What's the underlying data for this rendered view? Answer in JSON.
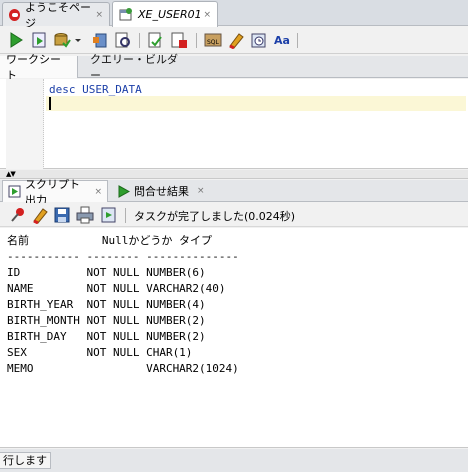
{
  "doc_tabs": [
    {
      "label": "ようこそページ",
      "close": "×"
    },
    {
      "label": "XE_USER01",
      "close": "×"
    }
  ],
  "toolbar_icons": [
    "run-statement-icon",
    "run-script-icon",
    "commit-icon",
    "rollback-icon",
    "autotrace-icon",
    "explain-plan-icon",
    "sql-tuning-icon",
    "monitor-icon",
    "clear-icon",
    "history-icon",
    "format-case-icon"
  ],
  "worksheet_tabs": {
    "worksheet": "ワークシート",
    "query_builder": "クエリー・ビルダー"
  },
  "editor": {
    "line1": "desc USER_DATA",
    "line2": ""
  },
  "output_tabs": [
    {
      "label": "スクリプト出力",
      "close": "×"
    },
    {
      "label": "問合せ結果",
      "close": "×"
    }
  ],
  "output_toolbar": {
    "status": "タスクが完了しました(0.024秒)"
  },
  "output": {
    "lines": [
      "名前           Nullかどうか タイプ",
      "----------- -------- --------------",
      "ID          NOT NULL NUMBER(6)",
      "NAME        NOT NULL VARCHAR2(40)",
      "BIRTH_YEAR  NOT NULL NUMBER(4)",
      "BIRTH_MONTH NOT NULL NUMBER(2)",
      "BIRTH_DAY   NOT NULL NUMBER(2)",
      "SEX         NOT NULL CHAR(1)",
      "MEMO                 VARCHAR2(1024)"
    ]
  },
  "statusbar": {
    "text": "行します"
  },
  "colors": {
    "keyword_blue": "#1c3fa8",
    "current_line": "#fbf7d6",
    "oracle_red": "#d32020",
    "run_green": "#2e9e2e"
  }
}
